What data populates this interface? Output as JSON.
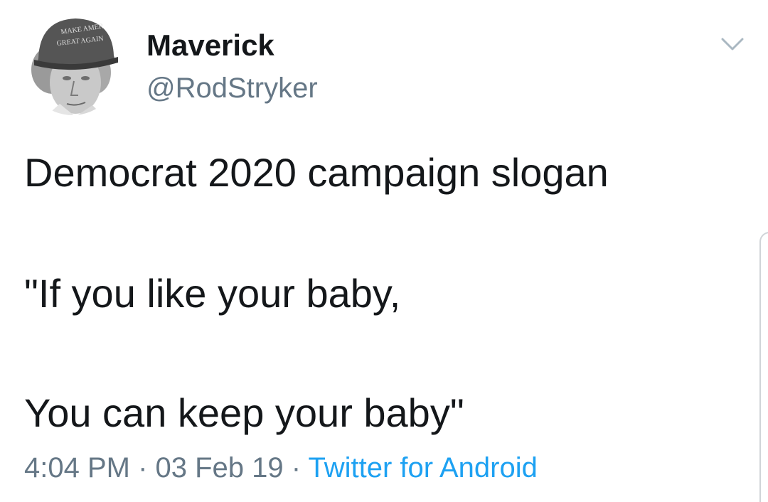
{
  "user": {
    "display_name": "Maverick",
    "handle": "@RodStryker",
    "avatar_hat_text": [
      "MAKE AMERICA",
      "GREAT AGAIN"
    ]
  },
  "tweet": {
    "lines": [
      "Democrat 2020 campaign slogan",
      "\"If you like your baby,",
      "You can keep your baby\""
    ]
  },
  "meta": {
    "time": "4:04 PM",
    "separator": " · ",
    "date": "03 Feb 19",
    "source": "Twitter for Android"
  },
  "icons": {
    "caret": "chevron-down-icon"
  },
  "colors": {
    "text": "#14171a",
    "muted": "#657786",
    "link": "#1da1f2"
  }
}
